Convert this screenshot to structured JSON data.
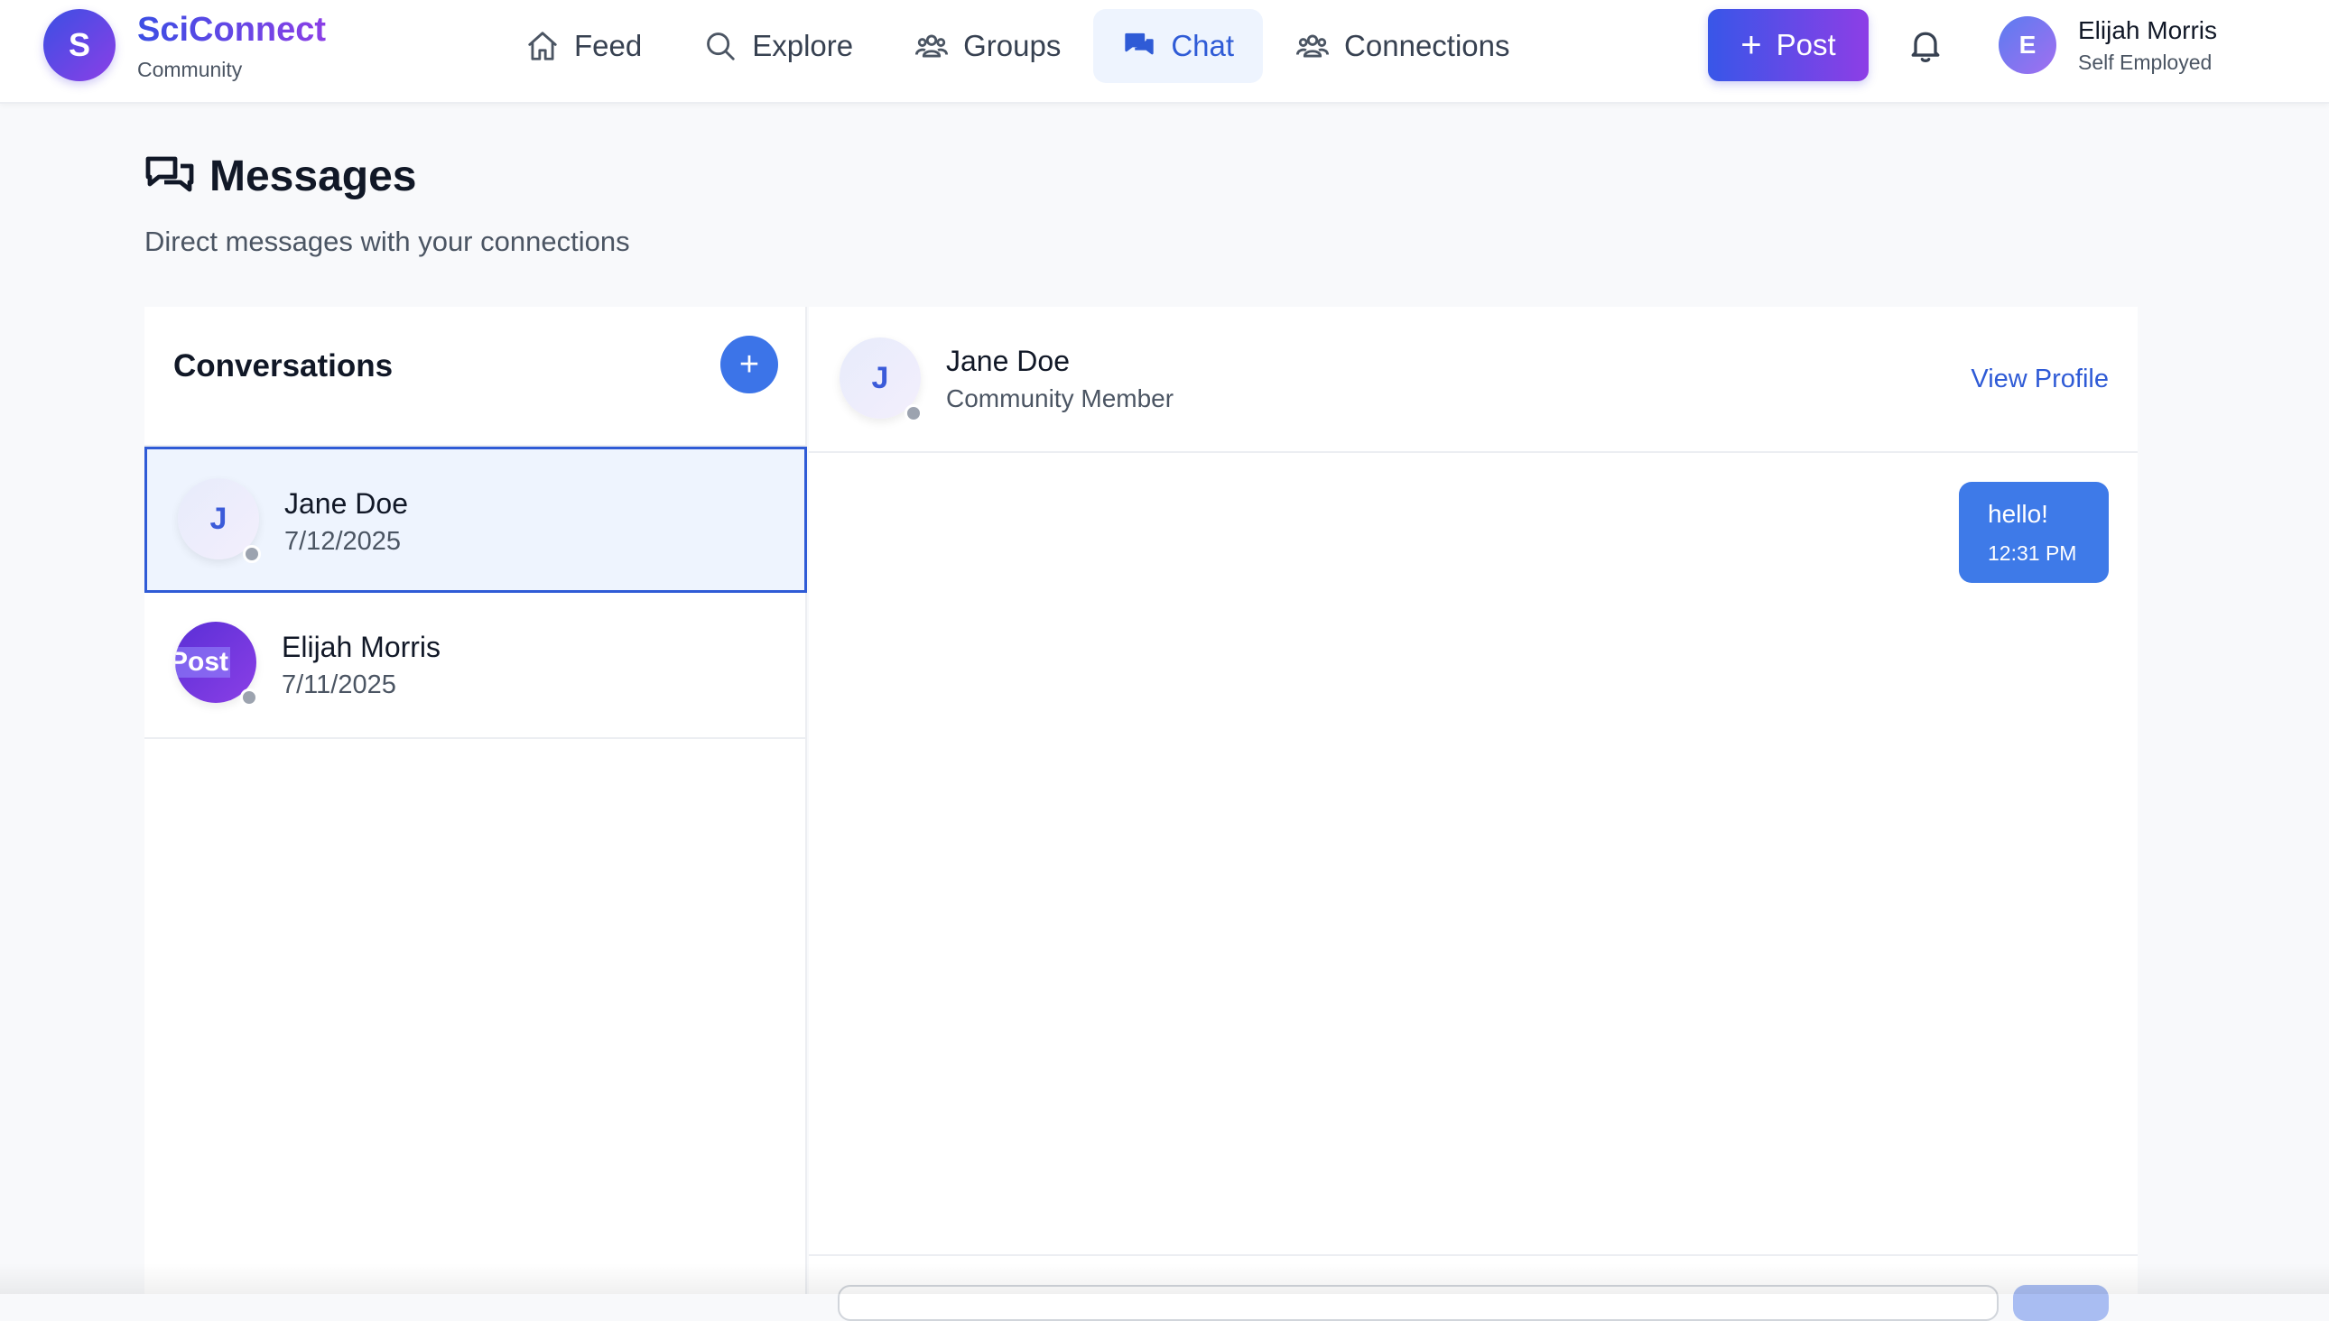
{
  "header": {
    "logo_letter": "S",
    "brand_name": "SciConnect",
    "brand_sub": "Community",
    "nav": [
      {
        "label": "Feed",
        "icon": "home-icon"
      },
      {
        "label": "Explore",
        "icon": "search-icon"
      },
      {
        "label": "Groups",
        "icon": "users-icon"
      },
      {
        "label": "Chat",
        "icon": "chat-icon",
        "active": true
      },
      {
        "label": "Connections",
        "icon": "users-icon"
      }
    ],
    "post_label": "Post",
    "bell_icon": "bell-icon",
    "user": {
      "initial": "E",
      "name": "Elijah Morris",
      "role": "Self Employed"
    }
  },
  "page": {
    "icon": "messages-icon",
    "title": "Messages",
    "subtitle": "Direct messages with your connections"
  },
  "conversations": {
    "title": "Conversations",
    "add_icon": "plus-icon",
    "items": [
      {
        "initial": "J",
        "name": "Jane Doe",
        "date": "7/12/2025",
        "selected": true
      },
      {
        "avatar_text": "Post",
        "name": "Elijah Morris",
        "date": "7/11/2025",
        "selected": false
      }
    ]
  },
  "chat": {
    "initial": "J",
    "name": "Jane Doe",
    "role": "Community Member",
    "view_profile": "View Profile",
    "messages": [
      {
        "text": "hello!",
        "time": "12:31 PM",
        "outgoing": true
      }
    ]
  },
  "colors": {
    "accent": "#2f5bd6",
    "bubble": "#3e7ae8",
    "brand_gradient_start": "#3b4fe4",
    "brand_gradient_end": "#8b3fe6",
    "status_offline": "#9ca3af"
  }
}
